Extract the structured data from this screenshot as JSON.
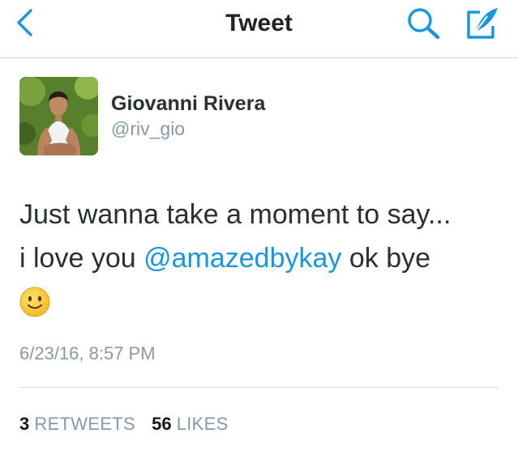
{
  "header": {
    "title": "Tweet",
    "back_icon": "chevron-left-icon",
    "search_icon": "search-icon",
    "compose_icon": "compose-tweet-icon",
    "accent_color": "#1b95e0"
  },
  "tweet": {
    "author_name": "Giovanni Rivera",
    "author_handle": "@riv_gio",
    "text_line1": "Just wanna take a moment to say...",
    "text_line2_prefix": "i love you ",
    "mention": "@amazedbykay",
    "text_line2_suffix": " ok bye",
    "emoji": "slightly-smiling-face-emoji",
    "timestamp": "6/23/16, 8:57 PM"
  },
  "stats": {
    "retweets_count": "3",
    "retweets_label": "RETWEETS",
    "likes_count": "56",
    "likes_label": "LIKES"
  }
}
